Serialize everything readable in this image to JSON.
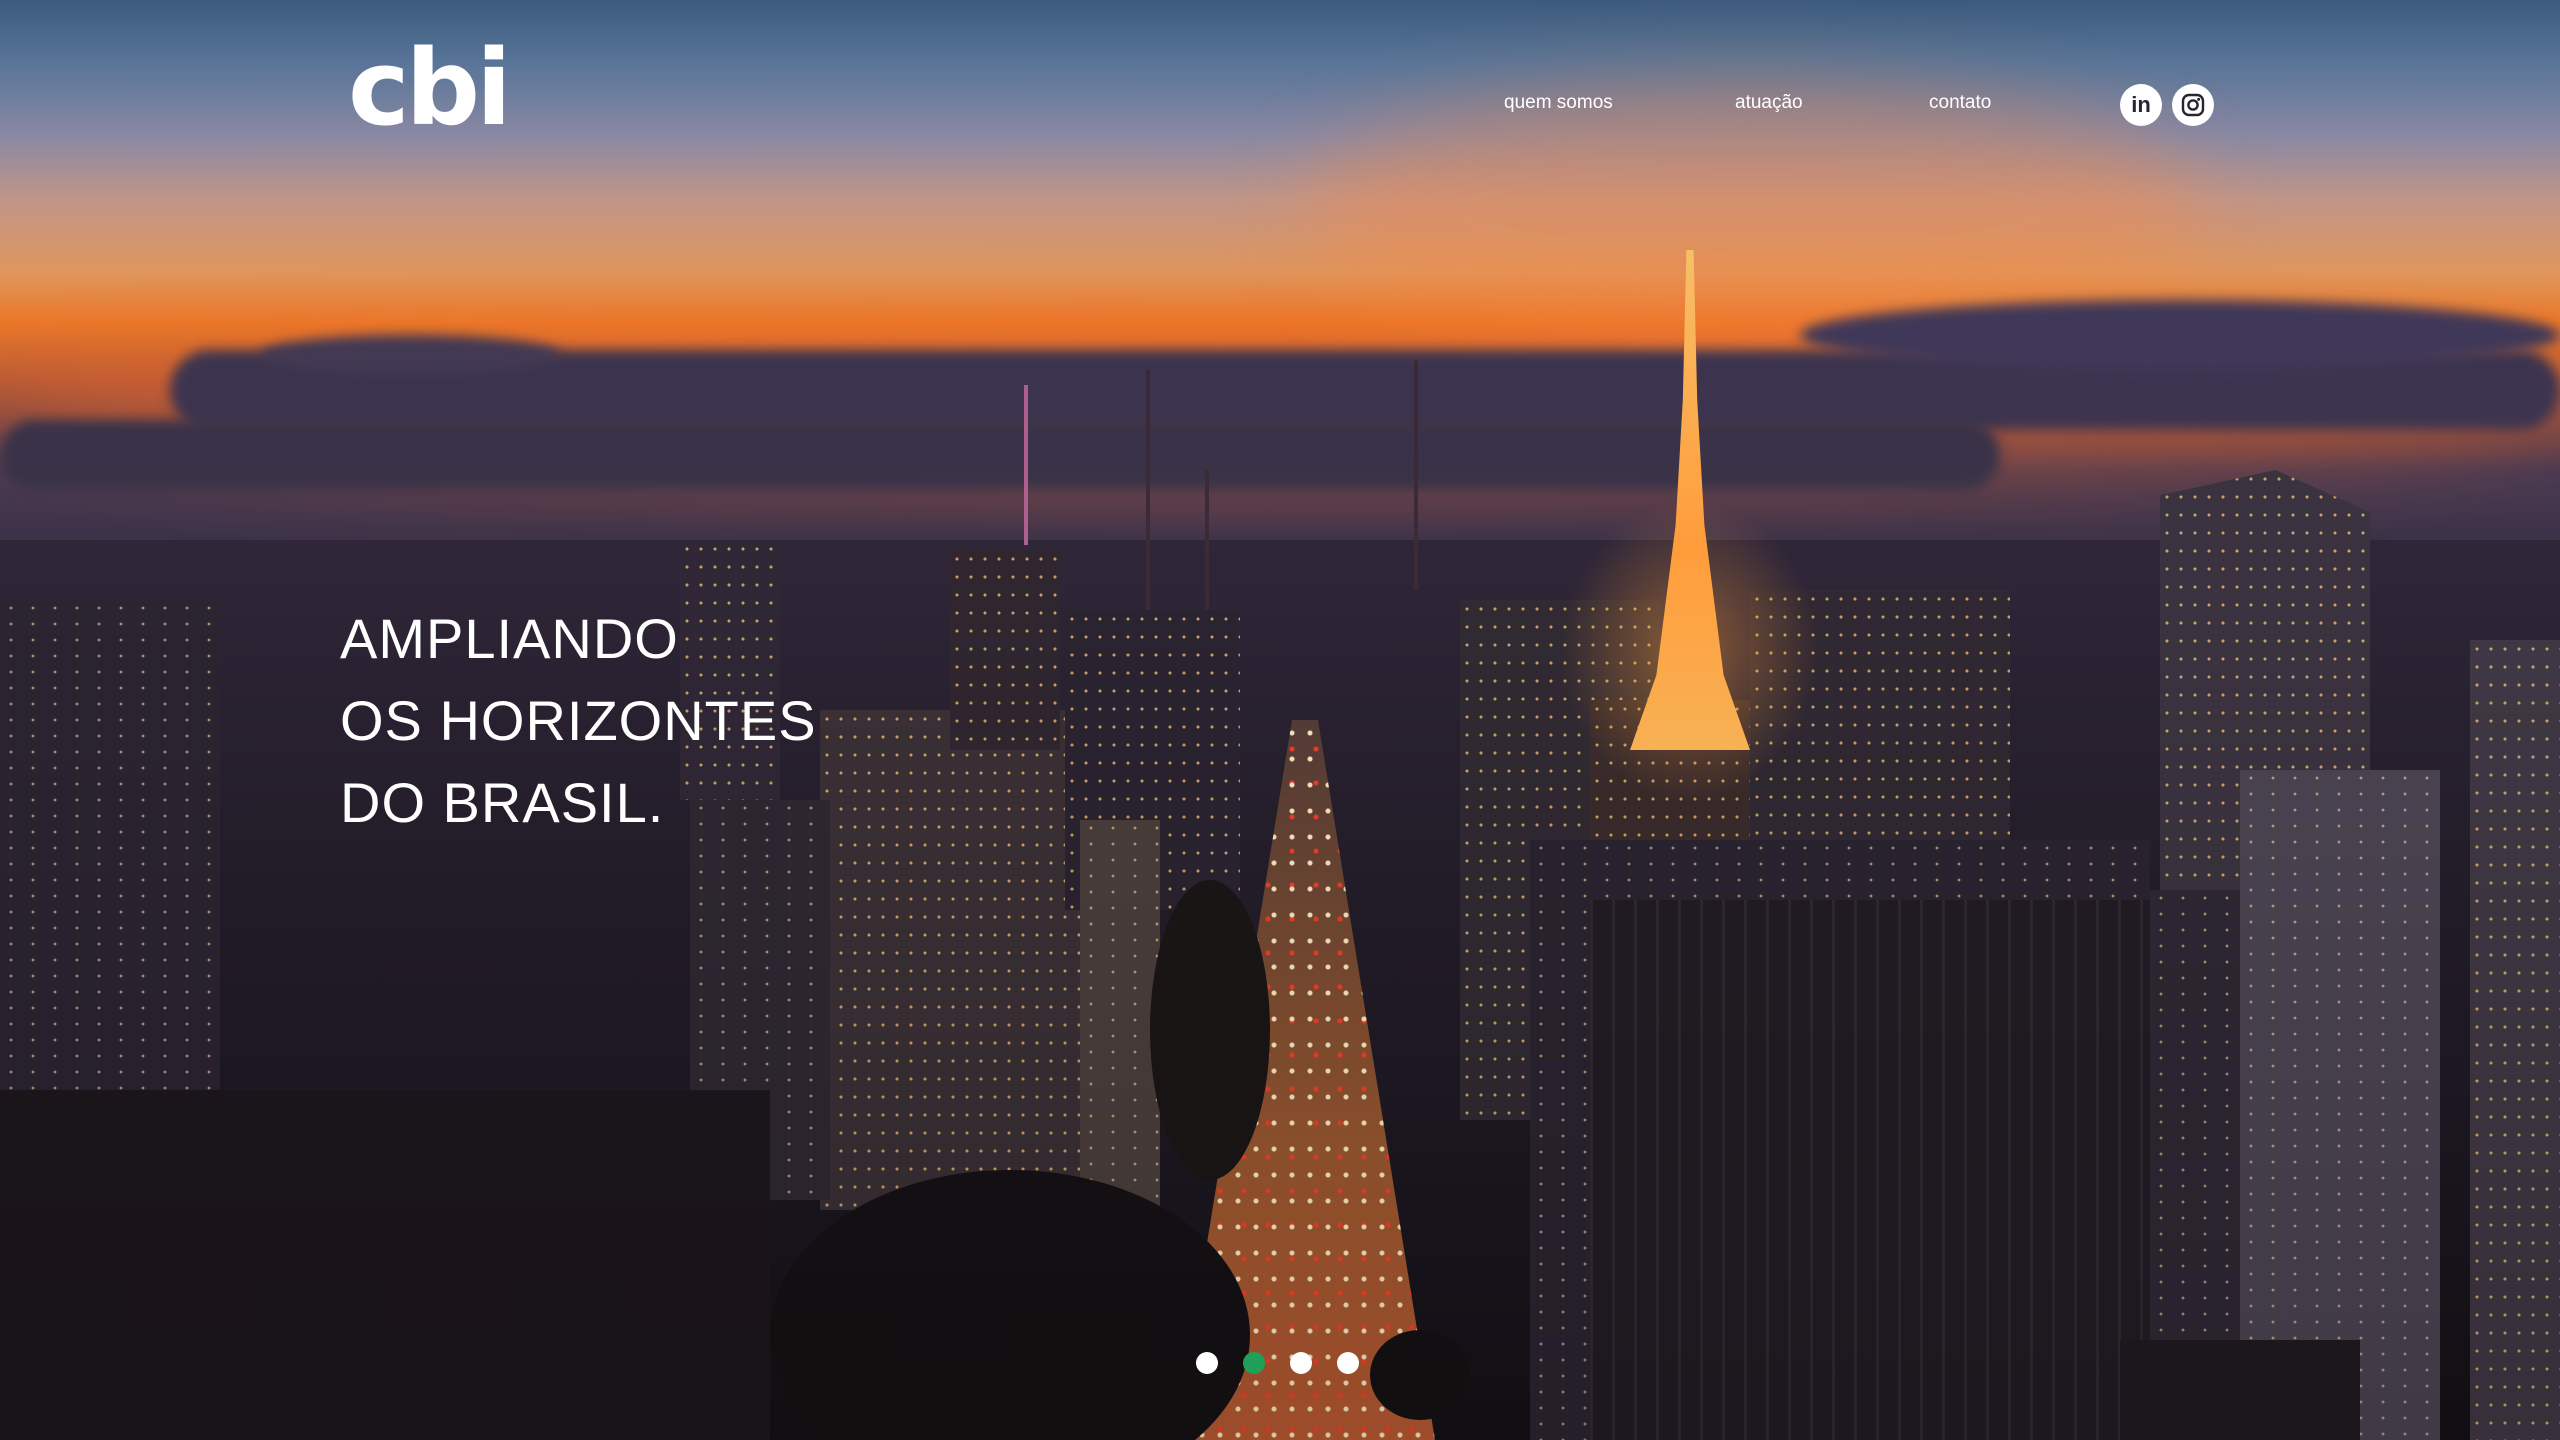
{
  "brand": {
    "logo_text": "cbi"
  },
  "nav": {
    "items": [
      {
        "label": "quem somos"
      },
      {
        "label": "atuação"
      },
      {
        "label": "contato"
      }
    ]
  },
  "social": {
    "linkedin": {
      "icon": "linkedin-icon",
      "glyph": "in"
    },
    "instagram": {
      "icon": "instagram-icon"
    }
  },
  "hero": {
    "tagline_lines": [
      "AMPLIANDO",
      "OS HORIZONTES",
      "DO BRASIL."
    ]
  },
  "slider": {
    "slides": 4,
    "active_index": 1,
    "active_color": "#1fa05a",
    "inactive_color": "#ffffff"
  },
  "colors": {
    "text": "#ffffff",
    "accent": "#1fa05a"
  }
}
